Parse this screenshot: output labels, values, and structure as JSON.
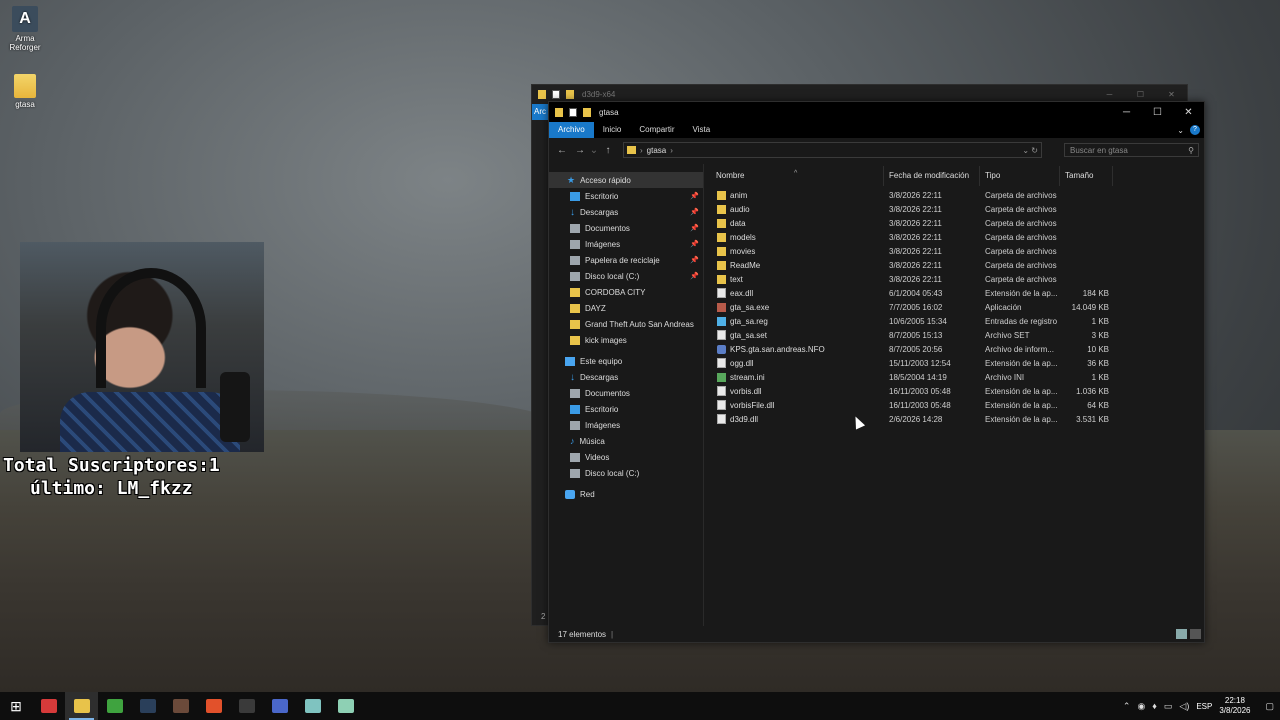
{
  "desktop": {
    "icons": [
      {
        "label": "Arma Reforger"
      },
      {
        "label": "gtasa"
      }
    ],
    "overlay": {
      "subs_total": "Total Suscriptores:1",
      "subs_last": "último: LM_fkzz"
    }
  },
  "back_window": {
    "title": "d3d9-x64",
    "ribbon_stub": "Arc",
    "status_stub": "2"
  },
  "window": {
    "title": "gtasa",
    "controls": {
      "minimize": "─",
      "maximize": "☐",
      "close": "✕"
    },
    "ribbon_tabs": [
      "Archivo",
      "Inicio",
      "Compartir",
      "Vista"
    ],
    "address": {
      "path": "gtasa"
    },
    "search": {
      "placeholder": "Buscar en gtasa"
    },
    "nav": {
      "quick_access": "Acceso rápido",
      "quick_items": [
        {
          "label": "Escritorio",
          "icon": "desktop-icon",
          "pinned": true
        },
        {
          "label": "Descargas",
          "icon": "download-icon",
          "pinned": true
        },
        {
          "label": "Documentos",
          "icon": "documents-icon",
          "pinned": true
        },
        {
          "label": "Imágenes",
          "icon": "pictures-icon",
          "pinned": true
        },
        {
          "label": "Papelera de reciclaje",
          "icon": "recycle-bin-icon",
          "pinned": true
        },
        {
          "label": "Disco local (C:)",
          "icon": "drive-icon",
          "pinned": true
        },
        {
          "label": "CORDOBA CITY",
          "icon": "folder-icon",
          "pinned": false
        },
        {
          "label": "DAYZ",
          "icon": "folder-icon",
          "pinned": false
        },
        {
          "label": "Grand Theft Auto San Andreas",
          "icon": "folder-icon",
          "pinned": false
        },
        {
          "label": "kick images",
          "icon": "folder-icon",
          "pinned": false
        }
      ],
      "this_pc": "Este equipo",
      "pc_items": [
        {
          "label": "Descargas",
          "icon": "download-icon"
        },
        {
          "label": "Documentos",
          "icon": "documents-icon"
        },
        {
          "label": "Escritorio",
          "icon": "desktop-icon"
        },
        {
          "label": "Imágenes",
          "icon": "pictures-icon"
        },
        {
          "label": "Música",
          "icon": "music-icon"
        },
        {
          "label": "Videos",
          "icon": "videos-icon"
        },
        {
          "label": "Disco local (C:)",
          "icon": "drive-icon"
        }
      ],
      "network": "Red"
    },
    "columns": {
      "name": "Nombre",
      "date": "Fecha de modificación",
      "type": "Tipo",
      "size": "Tamaño"
    },
    "files": [
      {
        "name": "anim",
        "date": "3/8/2026 22:11",
        "type": "Carpeta de archivos",
        "size": "",
        "icon": "folder"
      },
      {
        "name": "audio",
        "date": "3/8/2026 22:11",
        "type": "Carpeta de archivos",
        "size": "",
        "icon": "folder"
      },
      {
        "name": "data",
        "date": "3/8/2026 22:11",
        "type": "Carpeta de archivos",
        "size": "",
        "icon": "folder"
      },
      {
        "name": "models",
        "date": "3/8/2026 22:11",
        "type": "Carpeta de archivos",
        "size": "",
        "icon": "folder"
      },
      {
        "name": "movies",
        "date": "3/8/2026 22:11",
        "type": "Carpeta de archivos",
        "size": "",
        "icon": "folder"
      },
      {
        "name": "ReadMe",
        "date": "3/8/2026 22:11",
        "type": "Carpeta de archivos",
        "size": "",
        "icon": "folder"
      },
      {
        "name": "text",
        "date": "3/8/2026 22:11",
        "type": "Carpeta de archivos",
        "size": "",
        "icon": "folder"
      },
      {
        "name": "eax.dll",
        "date": "6/1/2004 05:43",
        "type": "Extensión de la ap...",
        "size": "184 KB",
        "icon": "file"
      },
      {
        "name": "gta_sa.exe",
        "date": "7/7/2005 16:02",
        "type": "Aplicación",
        "size": "14.049 KB",
        "icon": "exe"
      },
      {
        "name": "gta_sa.reg",
        "date": "10/6/2005 15:34",
        "type": "Entradas de registro",
        "size": "1 KB",
        "icon": "reg"
      },
      {
        "name": "gta_sa.set",
        "date": "8/7/2005 15:13",
        "type": "Archivo SET",
        "size": "3 KB",
        "icon": "file"
      },
      {
        "name": "KPS.gta.san.andreas.NFO",
        "date": "8/7/2005 20:56",
        "type": "Archivo de inform...",
        "size": "10 KB",
        "icon": "nfo"
      },
      {
        "name": "ogg.dll",
        "date": "15/11/2003 12:54",
        "type": "Extensión de la ap...",
        "size": "36 KB",
        "icon": "file"
      },
      {
        "name": "stream.ini",
        "date": "18/5/2004 14:19",
        "type": "Archivo INI",
        "size": "1 KB",
        "icon": "ini"
      },
      {
        "name": "vorbis.dll",
        "date": "16/11/2003 05:48",
        "type": "Extensión de la ap...",
        "size": "1.036 KB",
        "icon": "file"
      },
      {
        "name": "vorbisFile.dll",
        "date": "16/11/2003 05:48",
        "type": "Extensión de la ap...",
        "size": "64 KB",
        "icon": "file"
      },
      {
        "name": "d3d9.dll",
        "date": "2/6/2026 14:28",
        "type": "Extensión de la ap...",
        "size": "3.531 KB",
        "icon": "file"
      }
    ],
    "status": {
      "count": "17 elementos"
    }
  },
  "taskbar": {
    "apps": [
      {
        "name": "angry-app-icon",
        "color": "#d63a3a"
      },
      {
        "name": "file-explorer-icon",
        "color": "#e8c34a",
        "active": true
      },
      {
        "name": "xbox-icon",
        "color": "#3fa33f"
      },
      {
        "name": "steam-icon",
        "color": "#2a3f5a"
      },
      {
        "name": "game-app-icon",
        "color": "#6b4a3a"
      },
      {
        "name": "brave-icon",
        "color": "#e2512b"
      },
      {
        "name": "obs-icon",
        "color": "#3a3a3a"
      },
      {
        "name": "chrome-icon",
        "color": "#4a67c9"
      },
      {
        "name": "notepad-icon",
        "color": "#7fc3c0"
      },
      {
        "name": "notepad2-icon",
        "color": "#8ed0b4"
      }
    ],
    "lang": "ESP",
    "time": "22:18",
    "date": "3/8/2026"
  }
}
